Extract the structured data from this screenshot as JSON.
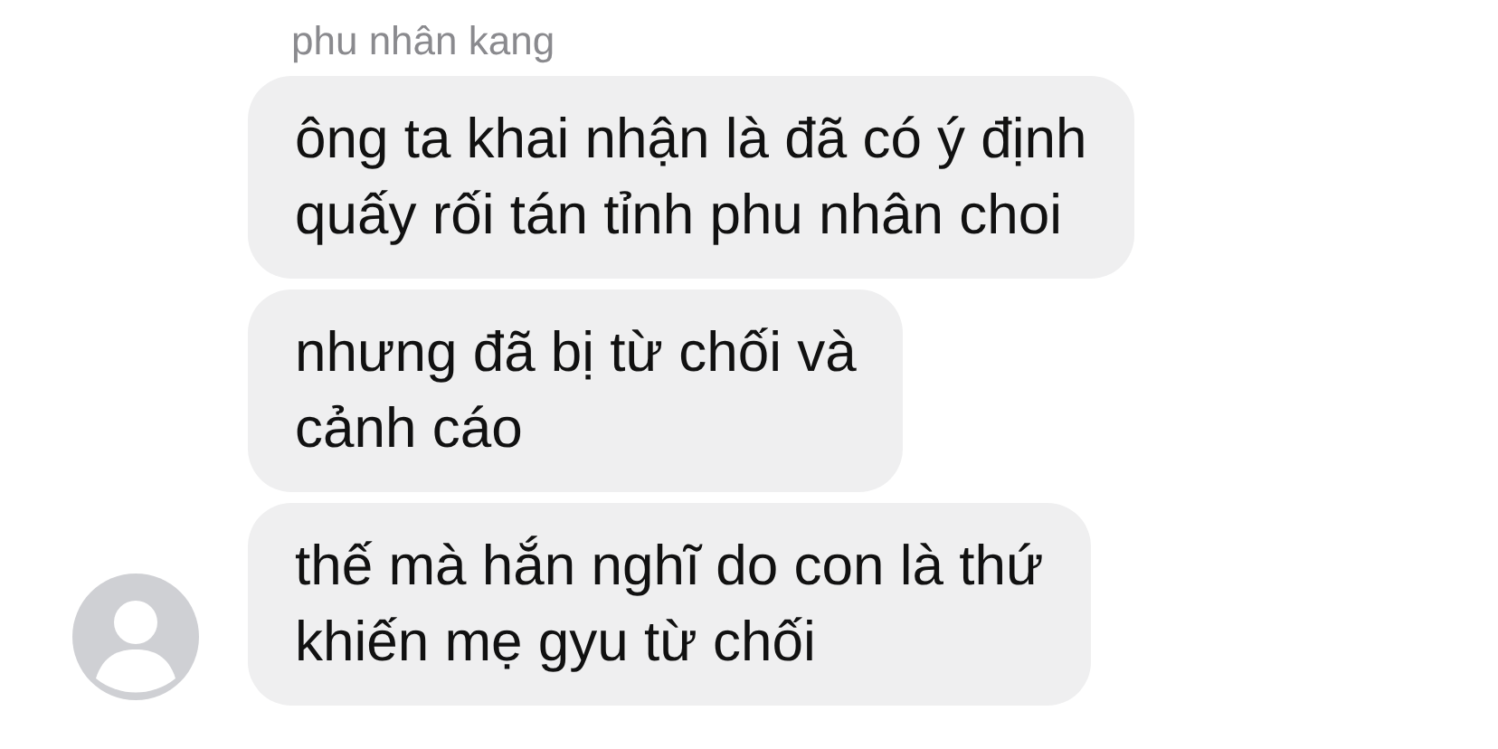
{
  "sender": {
    "name": "phu nhân kang"
  },
  "messages": [
    {
      "text": "ông ta khai nhận là đã có ý định\nquấy rối tán tỉnh phu nhân choi",
      "avatar": false
    },
    {
      "text": "nhưng đã bị từ chối và\ncảnh cáo",
      "avatar": false
    },
    {
      "text": "thế mà hắn nghĩ do con là thứ\nkhiến mẹ gyu từ chối",
      "avatar": true
    }
  ]
}
